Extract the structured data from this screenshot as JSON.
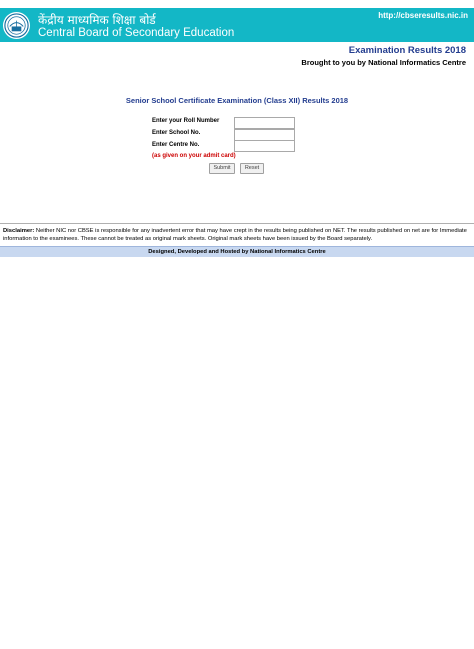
{
  "header": {
    "hindi_name": "केंद्रीय माध्यमिक शिक्षा बोर्ड",
    "english_name": "Central Board of Secondary Education",
    "site_url": "http://cbseresults.nic.in",
    "logo_icon": "cbse-emblem-icon"
  },
  "page": {
    "exam_results": "Examination Results 2018",
    "brought_by": "Brought to you by National Informatics Centre"
  },
  "form": {
    "title": "Senior School Certificate Examination (Class XII) Results 2018",
    "roll_label": "Enter your Roll Number",
    "roll_value": "",
    "school_label": "Enter School No.",
    "school_value": "",
    "centre_label": "Enter Centre No.",
    "centre_value": "",
    "admit_note": "(as given on your admit card)",
    "submit_label": "Submit",
    "reset_label": "Reset"
  },
  "disclaimer": {
    "heading": "Disclaimer:",
    "text": " Neither NIC nor CBSE is responsible for any inadvertent error that may have crept in the results being published on NET. The results published on net are for Immediate information to the examinees. These cannot be treated as original mark sheets. Original mark sheets have been issued by the Board separately."
  },
  "footer": {
    "text": "Designed, Developed and Hosted by National Informatics Centre"
  },
  "colors": {
    "header_bg": "#13b7c6",
    "title_blue": "#233d8f",
    "note_red": "#cc0000",
    "footer_bg": "#c8d8f0"
  }
}
